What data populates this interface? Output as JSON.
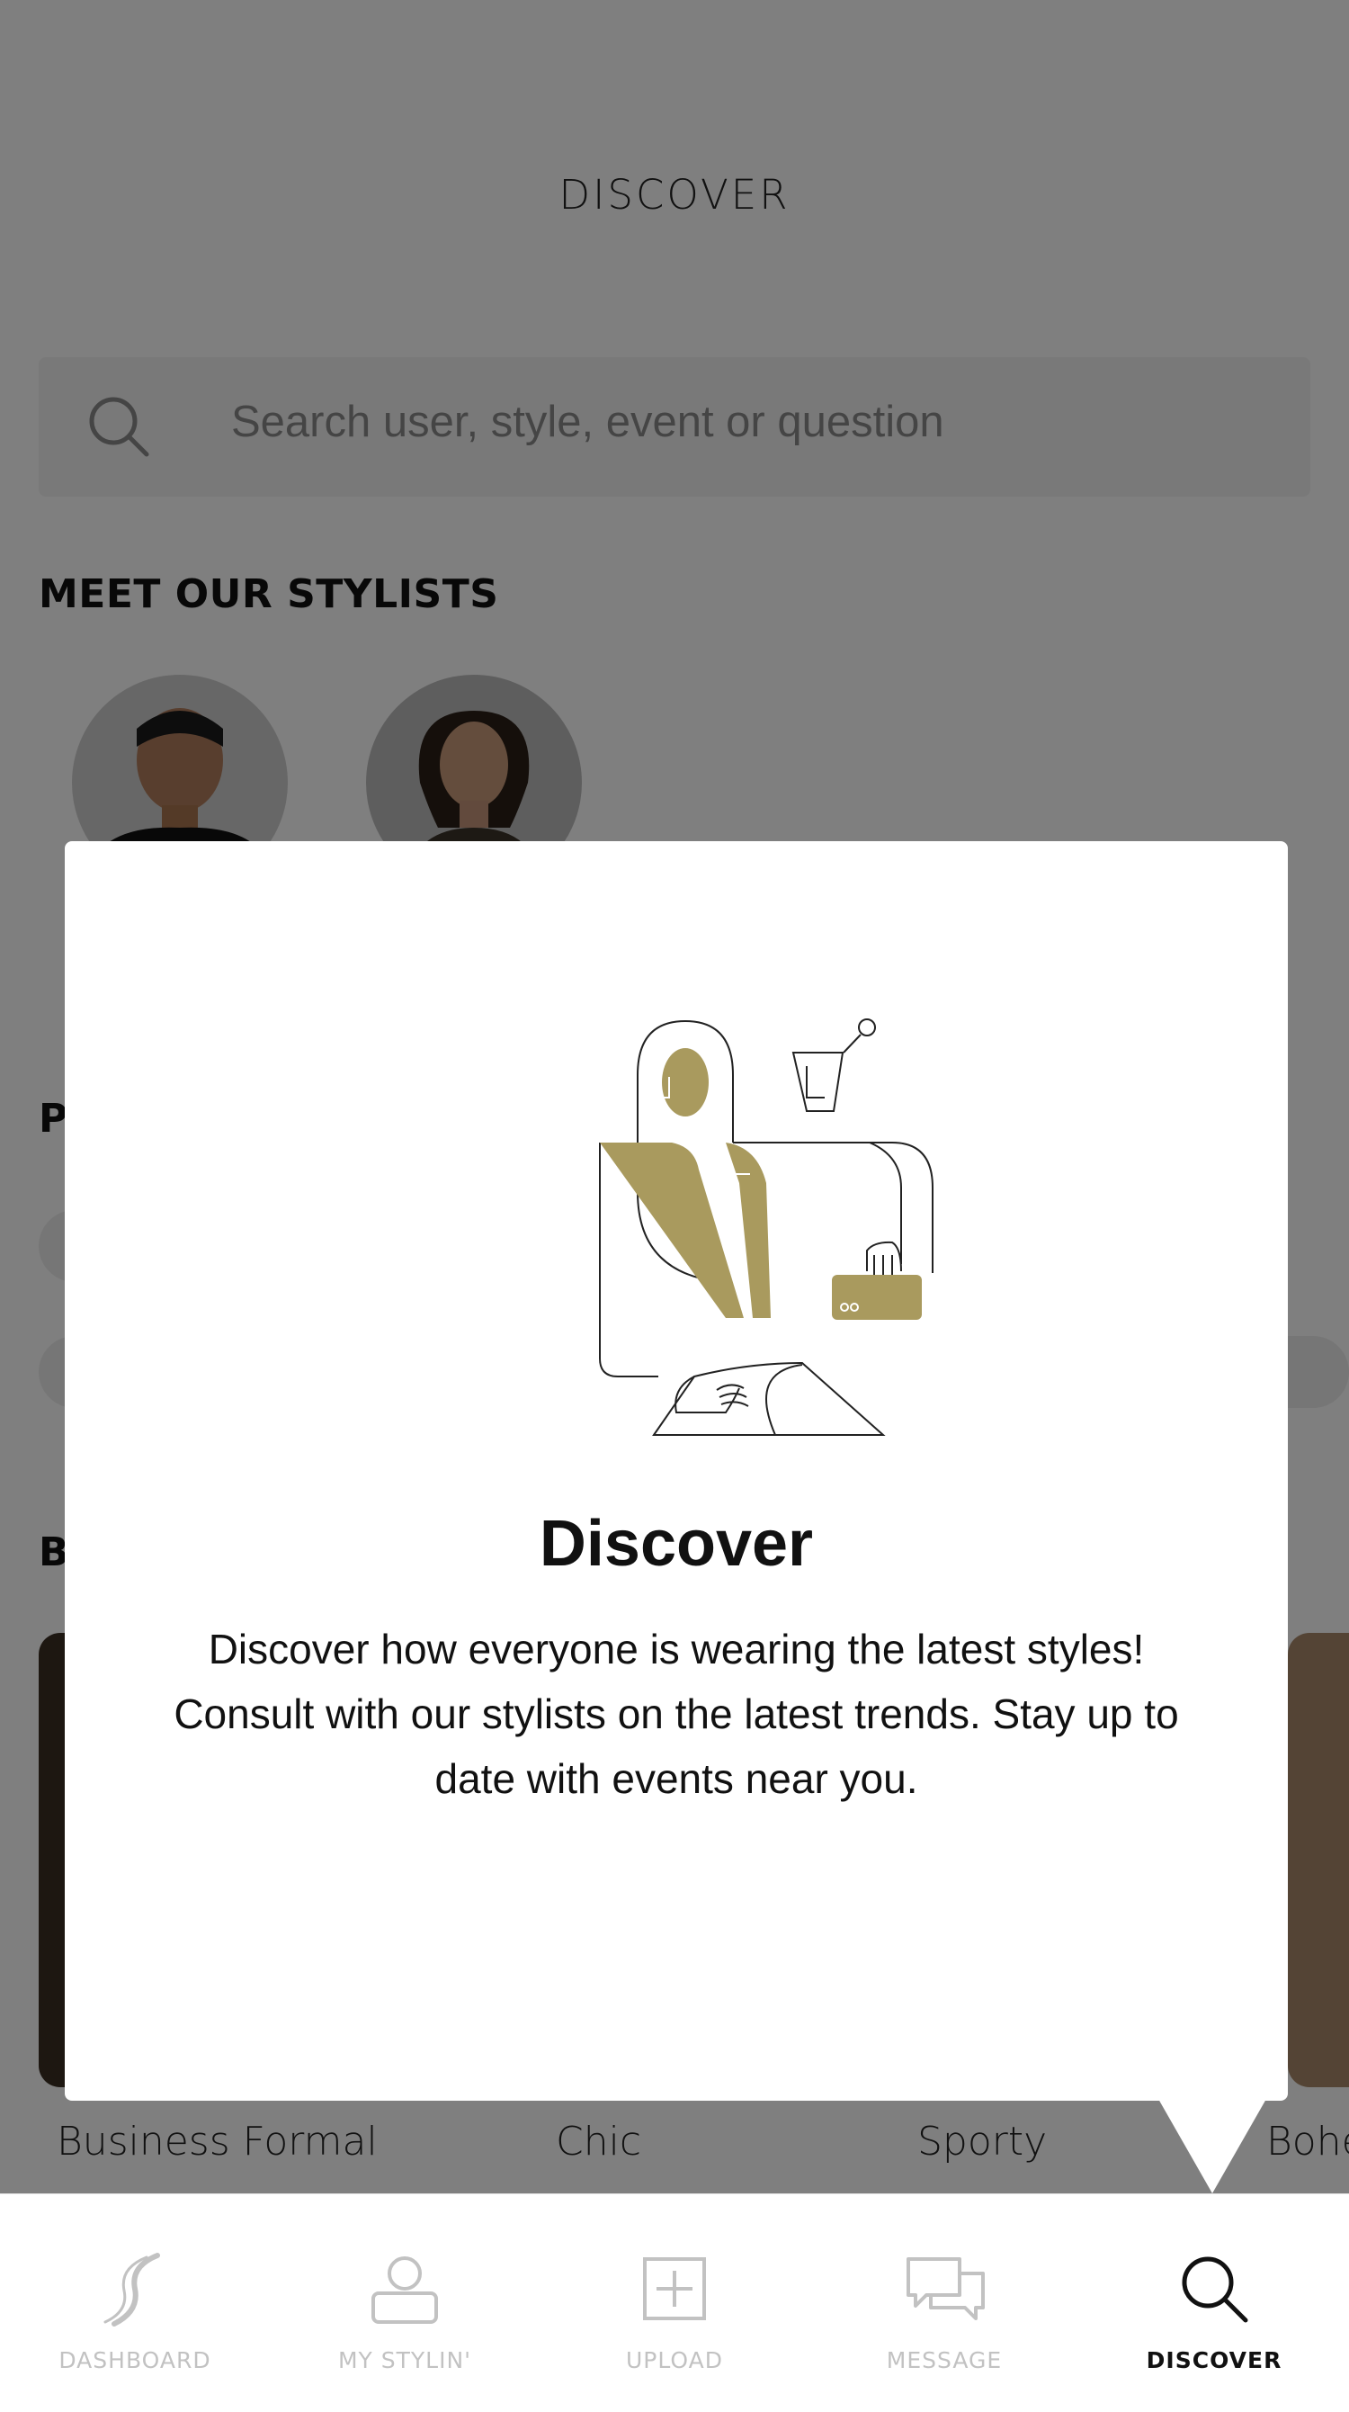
{
  "header": {
    "title": "DISCOVER"
  },
  "search": {
    "placeholder": "Search user, style, event or question",
    "icon": "search-icon"
  },
  "stylists": {
    "heading": "MEET OUR STYLISTS"
  },
  "sections": {
    "partial_heading_1": "P",
    "partial_heading_2": "B"
  },
  "styles": {
    "items": [
      {
        "label": "Business Formal"
      },
      {
        "label": "Chic"
      },
      {
        "label": "Sporty"
      },
      {
        "label": "Bohe"
      }
    ]
  },
  "modal": {
    "title": "Discover",
    "body": "Discover how everyone is wearing the latest styles! Consult with our stylists on the latest trends. Stay up to date with events near you.",
    "illustration": "stylist-illustration",
    "accent_color": "#A99A5E"
  },
  "tabbar": {
    "tabs": [
      {
        "label": "DASHBOARD",
        "icon": "stylin-logo-icon",
        "active": false
      },
      {
        "label": "MY STYLIN'",
        "icon": "profile-icon",
        "active": false
      },
      {
        "label": "UPLOAD",
        "icon": "upload-icon",
        "active": false
      },
      {
        "label": "MESSAGE",
        "icon": "message-icon",
        "active": false
      },
      {
        "label": "DISCOVER",
        "icon": "search-icon",
        "active": true
      }
    ]
  }
}
